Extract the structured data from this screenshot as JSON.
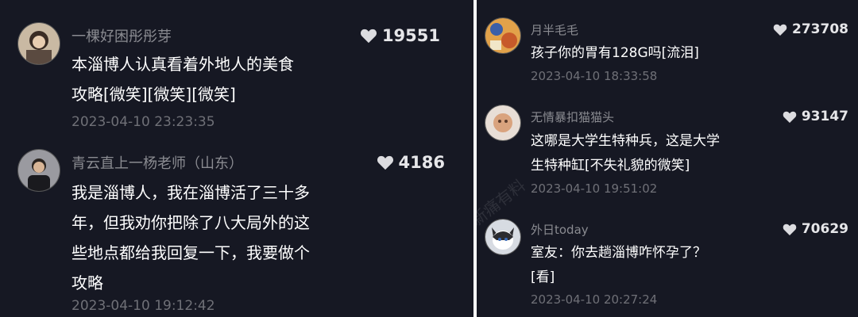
{
  "left_panel": {
    "comments": [
      {
        "username": "一棵好困彤彤芽",
        "likes": "19551",
        "text": "本淄博人认真看着外地人的美食\n攻略[微笑][微笑][微笑]",
        "time": "2023-04-10 23:23:35",
        "avatar_icon": "user-avatar-photo"
      },
      {
        "username": "青云直上一杨老师（山东）",
        "likes": "4186",
        "text": "我是淄博人，我在淄博活了三十多\n年，但我劝你把除了八大局外的这\n些地点都给我回复一下，我要做个\n攻略",
        "time": "2023-04-10 19:12:42",
        "avatar_icon": "user-avatar-photo"
      }
    ]
  },
  "right_panel": {
    "watermark": "新痛有料",
    "comments": [
      {
        "username": "月半毛毛",
        "likes": "273708",
        "text": "孩子你的胃有128G吗[流泪]",
        "time": "2023-04-10 18:33:58",
        "avatar_icon": "user-avatar-photo"
      },
      {
        "username": "无情暴扣猫猫头",
        "likes": "93147",
        "text": "这哪是大学生特种兵，这是大学\n生特种缸[不失礼貌的微笑]",
        "time": "2023-04-10 19:51:02",
        "avatar_icon": "user-avatar-photo"
      },
      {
        "username": "外日today",
        "likes": "70629",
        "text": "室友：你去趟淄博咋怀孕了？\n[看]",
        "time": "2023-04-10 20:27:24",
        "avatar_icon": "user-avatar-photo"
      }
    ]
  },
  "colors": {
    "background": "#161823",
    "username": "#8a8b91",
    "text": "#ffffff",
    "time": "#6f7077",
    "likes": "#e6e6e9"
  },
  "icons": {
    "like": "heart-icon"
  }
}
